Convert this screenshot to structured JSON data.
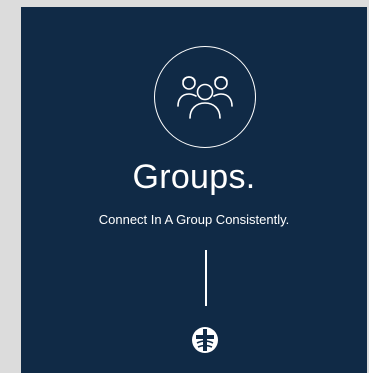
{
  "card": {
    "title": "Groups.",
    "subtitle": "Connect In A Group Consistently.",
    "feature_icon": "people-group-icon",
    "logo_icon": "church-logo-icon"
  },
  "colors": {
    "page_background": "#dcdcdc",
    "card_background": "#102a46",
    "foreground": "#ffffff"
  }
}
